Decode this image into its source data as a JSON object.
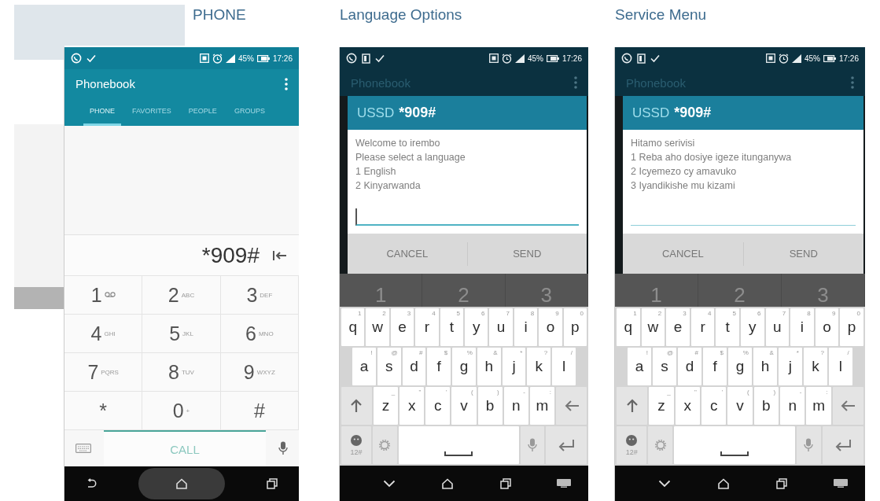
{
  "phones": [
    {
      "kind": "dialer",
      "caption": "PHONE",
      "status_bar": {
        "battery": "45%",
        "time": "17:26"
      },
      "app_bar": {
        "title": "Phonebook"
      },
      "tabs": [
        {
          "label": "PHONE",
          "selected": true
        },
        {
          "label": "FAVORITES",
          "selected": false
        },
        {
          "label": "PEOPLE",
          "selected": false
        },
        {
          "label": "GROUPS",
          "selected": false
        }
      ],
      "number": "*909#",
      "keys": [
        {
          "kind": "voicemail",
          "digit": "1"
        },
        {
          "kind": "digit",
          "digit": "2",
          "letters": "ABC"
        },
        {
          "kind": "digit",
          "digit": "3",
          "letters": "DEF"
        },
        {
          "kind": "digit",
          "digit": "4",
          "letters": "GHI"
        },
        {
          "kind": "digit",
          "digit": "5",
          "letters": "JKL"
        },
        {
          "kind": "digit",
          "digit": "6",
          "letters": "MNO"
        },
        {
          "kind": "digit",
          "digit": "7",
          "letters": "PQRS"
        },
        {
          "kind": "digit",
          "digit": "8",
          "letters": "TUV"
        },
        {
          "kind": "digit",
          "digit": "9",
          "letters": "WXYZ"
        },
        {
          "kind": "digit",
          "digit": "*"
        },
        {
          "kind": "digit",
          "digit": "0",
          "letters": "+"
        },
        {
          "kind": "digit",
          "digit": "#"
        }
      ],
      "call_label": "CALL"
    },
    {
      "kind": "ussd",
      "caption": "Language Options",
      "status_bar": {
        "battery": "45%",
        "time": "17:26"
      },
      "app_bar": {
        "title": "Phonebook"
      },
      "dialog": {
        "label": "USSD",
        "code": "*909#",
        "lines": [
          "Welcome to irembo",
          "Please select a language",
          "1 English",
          "2 Kinyarwanda"
        ],
        "reply_field": {
          "focused": true
        },
        "buttons": [
          "CANCEL",
          "SEND"
        ]
      },
      "dialpad_peek": [
        "1",
        "2",
        "3"
      ],
      "keyboard": {
        "rows": [
          [
            {
              "kind": "char",
              "key": "q",
              "hint": "1"
            },
            {
              "kind": "char",
              "key": "w",
              "hint": "2"
            },
            {
              "kind": "char",
              "key": "e",
              "hint": "3"
            },
            {
              "kind": "char",
              "key": "r",
              "hint": "4"
            },
            {
              "kind": "char",
              "key": "t",
              "hint": "5"
            },
            {
              "kind": "char",
              "key": "y",
              "hint": "6"
            },
            {
              "kind": "char",
              "key": "u",
              "hint": "7"
            },
            {
              "kind": "char",
              "key": "i",
              "hint": "8"
            },
            {
              "kind": "char",
              "key": "o",
              "hint": "9"
            },
            {
              "kind": "char",
              "key": "p",
              "hint": "0"
            }
          ],
          [
            {
              "kind": "char",
              "key": "a",
              "hint": "!"
            },
            {
              "kind": "char",
              "key": "s",
              "hint": "@"
            },
            {
              "kind": "char",
              "key": "d",
              "hint": "#"
            },
            {
              "kind": "char",
              "key": "f",
              "hint": "$"
            },
            {
              "kind": "char",
              "key": "g",
              "hint": "%"
            },
            {
              "kind": "char",
              "key": "h",
              "hint": "&"
            },
            {
              "kind": "char",
              "key": "j",
              "hint": "*"
            },
            {
              "kind": "char",
              "key": "k",
              "hint": "?"
            },
            {
              "kind": "char",
              "key": "l",
              "hint": "/"
            }
          ],
          [
            {
              "kind": "shift"
            },
            {
              "kind": "char",
              "key": "z",
              "hint": "_"
            },
            {
              "kind": "char",
              "key": "x",
              "hint": "\""
            },
            {
              "kind": "char",
              "key": "c",
              "hint": "'"
            },
            {
              "kind": "char",
              "key": "v",
              "hint": "("
            },
            {
              "kind": "char",
              "key": "b",
              "hint": ")"
            },
            {
              "kind": "char",
              "key": "n",
              "hint": "-"
            },
            {
              "kind": "char",
              "key": "m",
              "hint": ":"
            },
            {
              "kind": "backspace"
            }
          ],
          [
            {
              "kind": "emoji",
              "label": "12#"
            },
            {
              "kind": "settings"
            },
            {
              "kind": "space"
            },
            {
              "kind": "mic"
            },
            {
              "kind": "enter"
            }
          ]
        ]
      }
    },
    {
      "kind": "ussd",
      "caption": "Service Menu",
      "status_bar": {
        "battery": "45%",
        "time": "17:26"
      },
      "app_bar": {
        "title": "Phonebook"
      },
      "dialog": {
        "label": "USSD",
        "code": "*909#",
        "lines": [
          "Hitamo serivisi",
          "1 Reba aho dosiye igeze itunganywa",
          "2 Icyemezo cy amavuko",
          "3 Iyandikishe mu kizami"
        ],
        "reply_field": {
          "focused": false
        },
        "buttons": [
          "CANCEL",
          "SEND"
        ]
      },
      "dialpad_peek": [
        "1",
        "2",
        "3"
      ],
      "keyboard": {
        "rows": [
          [
            {
              "kind": "char",
              "key": "q",
              "hint": "1"
            },
            {
              "kind": "char",
              "key": "w",
              "hint": "2"
            },
            {
              "kind": "char",
              "key": "e",
              "hint": "3"
            },
            {
              "kind": "char",
              "key": "r",
              "hint": "4"
            },
            {
              "kind": "char",
              "key": "t",
              "hint": "5"
            },
            {
              "kind": "char",
              "key": "y",
              "hint": "6"
            },
            {
              "kind": "char",
              "key": "u",
              "hint": "7"
            },
            {
              "kind": "char",
              "key": "i",
              "hint": "8"
            },
            {
              "kind": "char",
              "key": "o",
              "hint": "9"
            },
            {
              "kind": "char",
              "key": "p",
              "hint": "0"
            }
          ],
          [
            {
              "kind": "char",
              "key": "a",
              "hint": "!"
            },
            {
              "kind": "char",
              "key": "s",
              "hint": "@"
            },
            {
              "kind": "char",
              "key": "d",
              "hint": "#"
            },
            {
              "kind": "char",
              "key": "f",
              "hint": "$"
            },
            {
              "kind": "char",
              "key": "g",
              "hint": "%"
            },
            {
              "kind": "char",
              "key": "h",
              "hint": "&"
            },
            {
              "kind": "char",
              "key": "j",
              "hint": "*"
            },
            {
              "kind": "char",
              "key": "k",
              "hint": "?"
            },
            {
              "kind": "char",
              "key": "l",
              "hint": "/"
            }
          ],
          [
            {
              "kind": "shift"
            },
            {
              "kind": "char",
              "key": "z",
              "hint": "_"
            },
            {
              "kind": "char",
              "key": "x",
              "hint": "\""
            },
            {
              "kind": "char",
              "key": "c",
              "hint": "'"
            },
            {
              "kind": "char",
              "key": "v",
              "hint": "("
            },
            {
              "kind": "char",
              "key": "b",
              "hint": ")"
            },
            {
              "kind": "char",
              "key": "n",
              "hint": "-"
            },
            {
              "kind": "char",
              "key": "m",
              "hint": ":"
            },
            {
              "kind": "backspace"
            }
          ],
          [
            {
              "kind": "emoji",
              "label": "12#"
            },
            {
              "kind": "settings"
            },
            {
              "kind": "space"
            },
            {
              "kind": "mic"
            },
            {
              "kind": "enter"
            }
          ]
        ]
      }
    }
  ]
}
